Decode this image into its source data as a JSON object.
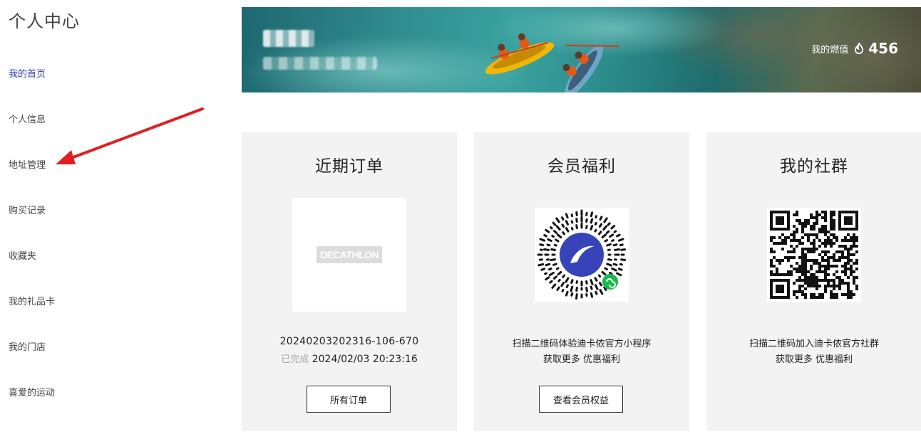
{
  "sidebar": {
    "title": "个人中心",
    "items": [
      {
        "label": "我的首页",
        "active": true
      },
      {
        "label": "个人信息"
      },
      {
        "label": "地址管理"
      },
      {
        "label": "购买记录"
      },
      {
        "label": "收藏夹"
      },
      {
        "label": "我的礼品卡"
      },
      {
        "label": "我的门店"
      },
      {
        "label": "喜爱的运动"
      }
    ]
  },
  "banner": {
    "points_label": "我的燃值",
    "points_icon": "flame-icon",
    "points_value": "456"
  },
  "cards": {
    "orders": {
      "title": "近期订单",
      "logo_text": "DECATHLON",
      "order_id": "20240203202316-106-670",
      "status": "已完成",
      "datetime": "2024/02/03 20:23:16",
      "button": "所有订单"
    },
    "benefits": {
      "title": "会员福利",
      "line1": "扫描二维码体验迪卡侬官方小程序",
      "line2": "获取更多 优惠福利",
      "button": "查看会员权益"
    },
    "community": {
      "title": "我的社群",
      "line1": "扫描二维码加入迪卡侬官方社群",
      "line2": "获取更多 优惠福利"
    }
  },
  "colors": {
    "accent": "#3643ba",
    "annotation_arrow": "#e02020",
    "card_bg": "#f3f3f3"
  }
}
